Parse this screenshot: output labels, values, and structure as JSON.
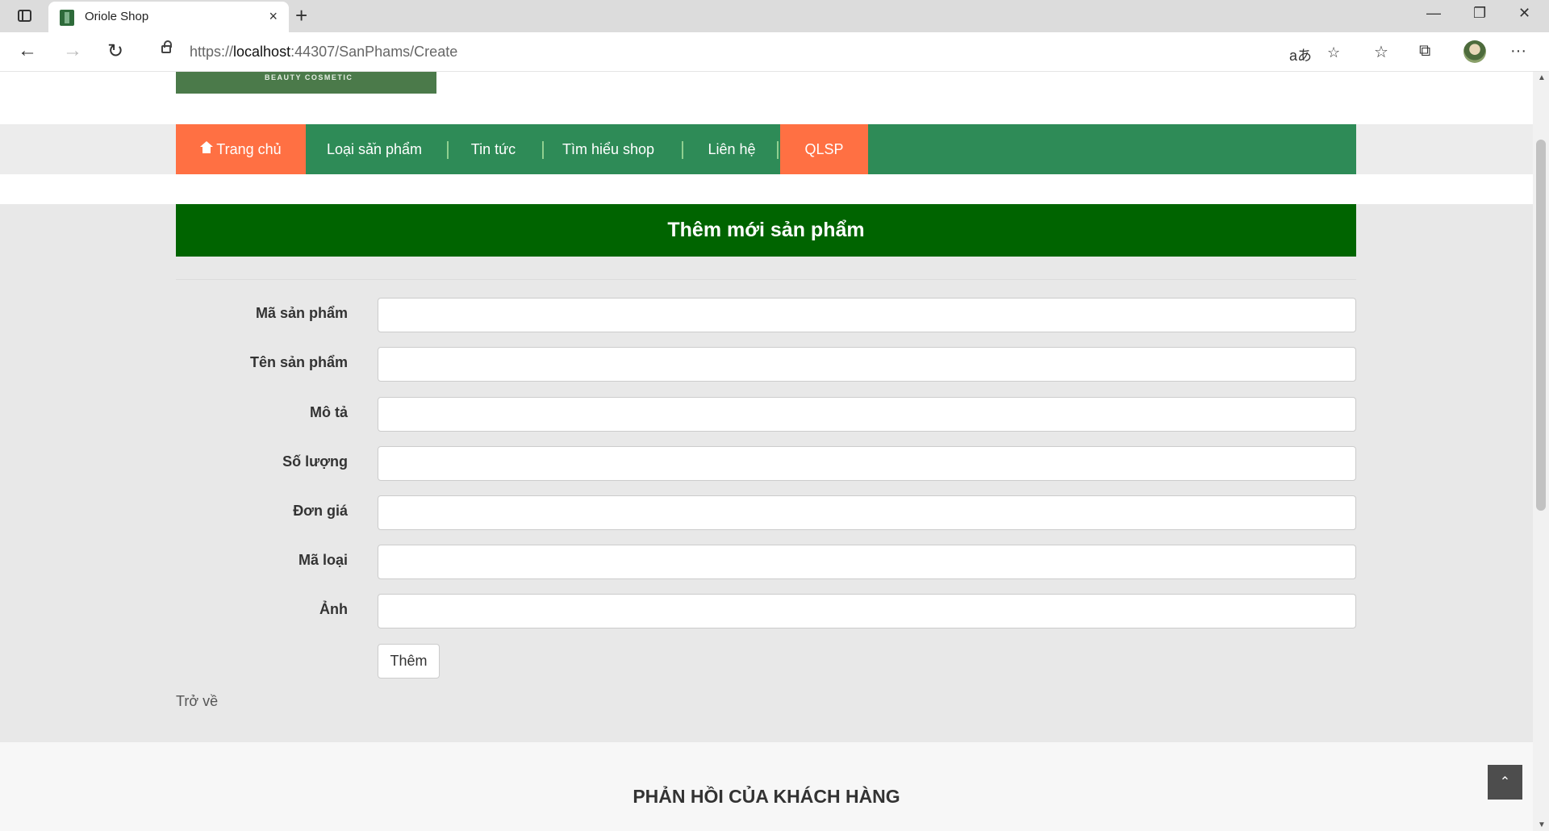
{
  "browser": {
    "tab_title": "Oriole Shop",
    "tab_close": "×",
    "new_tab": "+",
    "url_prefix": "https://",
    "url_host": "localhost",
    "url_rest": ":44307/SanPhams/Create",
    "minimize": "—",
    "restore": "❐",
    "close": "✕",
    "back": "←",
    "forward": "→",
    "reload": "↻",
    "read_aloud": "aあ",
    "favorite": "☆",
    "favorites": "☆",
    "collections": "⧉",
    "more": "···"
  },
  "header": {
    "logo_text": "BEAUTY COSMETIC"
  },
  "nav": {
    "items": [
      {
        "label": "Trang chủ"
      },
      {
        "label": "Loại sản phẩm"
      },
      {
        "label": "Tin tức"
      },
      {
        "label": "Tìm hiểu shop"
      },
      {
        "label": "Liên hệ"
      },
      {
        "label": "QLSP"
      }
    ],
    "dropdown_chevron": "⌄"
  },
  "page": {
    "title": "Thêm mới sản phẩm"
  },
  "form": {
    "fields": [
      {
        "label": "Mã sản phẩm",
        "value": ""
      },
      {
        "label": "Tên sản phẩm",
        "value": ""
      },
      {
        "label": "Mô tả",
        "value": ""
      },
      {
        "label": "Số lượng",
        "value": ""
      },
      {
        "label": "Đơn giá",
        "value": ""
      },
      {
        "label": "Mã loại",
        "value": ""
      },
      {
        "label": "Ảnh",
        "value": ""
      }
    ],
    "submit_label": "Thêm",
    "back_link": "Trở về"
  },
  "footer": {
    "title": "PHẢN HỒI CỦA KHÁCH HÀNG",
    "to_top": "⌃"
  },
  "colors": {
    "nav_green": "#2e8b57",
    "accent_orange": "#ff7043",
    "heading_green": "#006400"
  }
}
